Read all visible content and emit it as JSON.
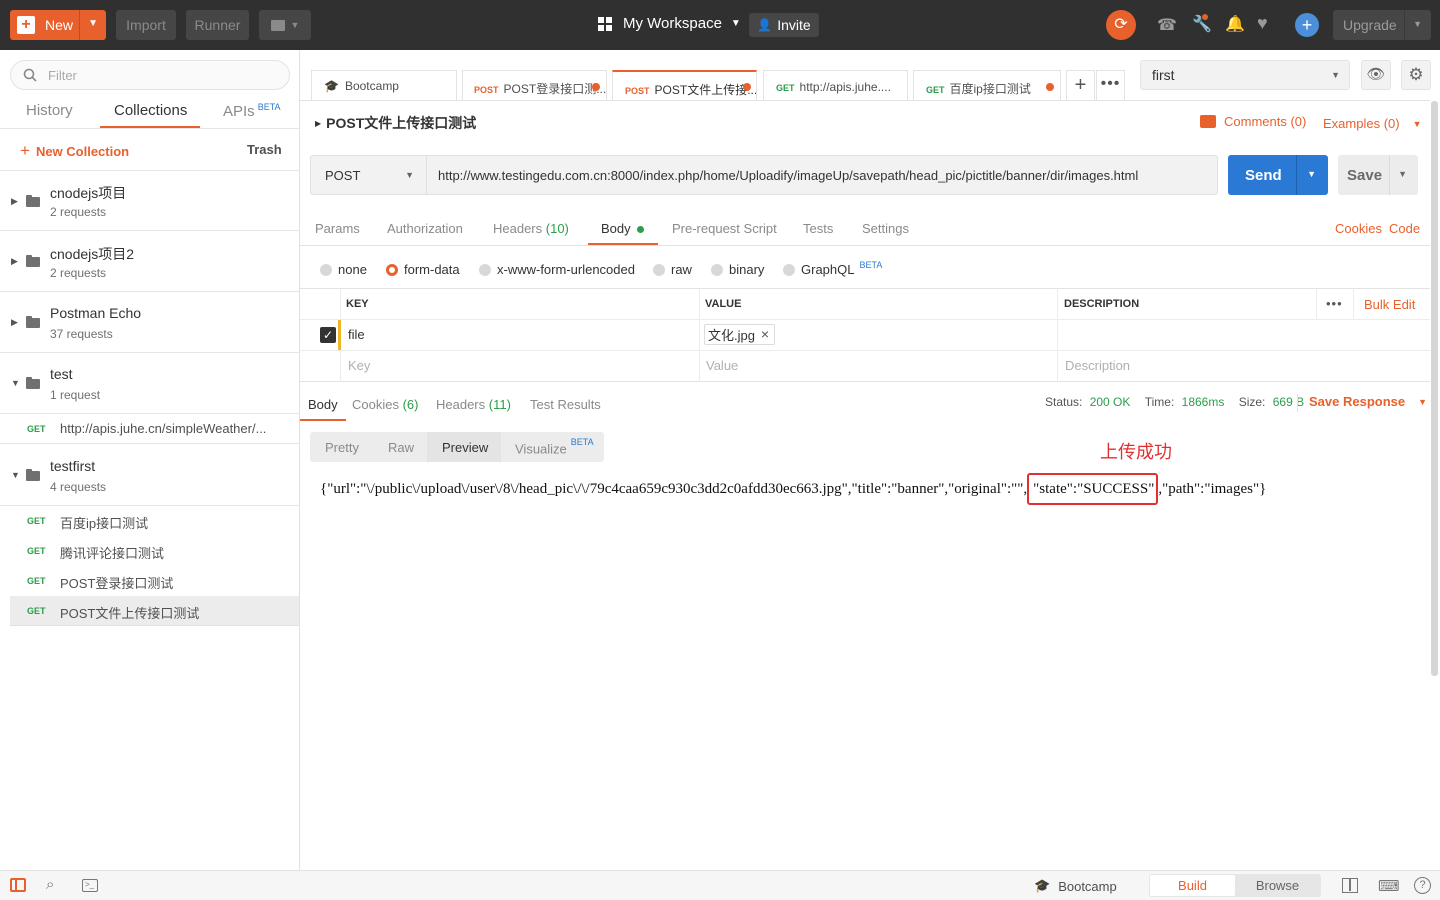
{
  "colors": {
    "accent": "#e8612c",
    "send": "#2a7ad5",
    "get": "#2b9e4a",
    "topbar": "#303030",
    "highlight": "#e03030"
  },
  "topbar": {
    "new_label": "New",
    "import_label": "Import",
    "runner_label": "Runner",
    "workspace": "My Workspace",
    "invite": "Invite",
    "upgrade": "Upgrade"
  },
  "sidebar": {
    "filter_placeholder": "Filter",
    "tabs": [
      "History",
      "Collections",
      "APIs"
    ],
    "apis_badge": "BETA",
    "new_collection": "New Collection",
    "trash": "Trash",
    "collections": [
      {
        "name": "cnodejs项目",
        "count": "2 requests"
      },
      {
        "name": "cnodejs项目2",
        "count": "2 requests"
      },
      {
        "name": "Postman Echo",
        "count": "37 requests"
      },
      {
        "name": "test",
        "count": "1 request"
      },
      {
        "name": "testfirst",
        "count": "4 requests"
      }
    ],
    "test_requests": [
      {
        "method": "GET",
        "title": "http://apis.juhe.cn/simpleWeather/..."
      }
    ],
    "testfirst_requests": [
      {
        "method": "GET",
        "title": "百度ip接口测试"
      },
      {
        "method": "GET",
        "title": "腾讯评论接口测试"
      },
      {
        "method": "GET",
        "title": "POST登录接口测试"
      },
      {
        "method": "GET",
        "title": "POST文件上传接口测试"
      }
    ]
  },
  "tabs": [
    {
      "method": "",
      "title": "Bootcamp"
    },
    {
      "method": "POST",
      "title": "POST登录接口测..."
    },
    {
      "method": "POST",
      "title": "POST文件上传接..."
    },
    {
      "method": "GET",
      "title": "http://apis.juhe...."
    },
    {
      "method": "GET",
      "title": "百度ip接口测试"
    }
  ],
  "environment": "first",
  "request": {
    "title": "POST文件上传接口测试",
    "comments": "Comments (0)",
    "examples": "Examples (0)",
    "method": "POST",
    "url": "http://www.testingedu.com.cn:8000/index.php/home/Uploadify/imageUp/savepath/head_pic/pictitle/banner/dir/images.html",
    "send": "Send",
    "save": "Save",
    "tabs": {
      "params": "Params",
      "authorization": "Authorization",
      "headers": "Headers",
      "headers_count": "(10)",
      "body": "Body",
      "prerequest": "Pre-request Script",
      "tests": "Tests",
      "settings": "Settings"
    },
    "cookies": "Cookies",
    "code": "Code",
    "body_modes": [
      "none",
      "form-data",
      "x-www-form-urlencoded",
      "raw",
      "binary",
      "GraphQL"
    ],
    "graphql_badge": "BETA",
    "columns": {
      "key": "KEY",
      "value": "VALUE",
      "description": "DESCRIPTION",
      "bulk_edit": "Bulk Edit"
    },
    "rows": [
      {
        "key": "file",
        "value": "文化.jpg"
      }
    ],
    "placeholders": {
      "key": "Key",
      "value": "Value",
      "description": "Description"
    }
  },
  "response": {
    "tabs": {
      "body": "Body",
      "cookies": "Cookies",
      "cookies_count": "(6)",
      "headers": "Headers",
      "headers_count": "(11)",
      "tests": "Test Results"
    },
    "status_label": "Status:",
    "status": "200 OK",
    "time_label": "Time:",
    "time": "1866ms",
    "size_label": "Size:",
    "size": "669 B",
    "save_response": "Save Response",
    "views": [
      "Pretty",
      "Raw",
      "Preview",
      "Visualize"
    ],
    "visualize_badge": "BETA",
    "annotation": "上传成功",
    "body_part1": "{\"url\":\"\\/public\\/upload\\/user\\/8\\/head_pic\\/\\/79c4caa659c930c3dd2c0afdd30ec663.jpg\",\"title\":\"banner\",\"original\":\"\",",
    "body_part2": "\"state\":\"SUCCESS\"",
    "body_part3": ",\"path\":\"images\"}"
  },
  "statusbar": {
    "bootcamp": "Bootcamp",
    "build": "Build",
    "browse": "Browse"
  }
}
